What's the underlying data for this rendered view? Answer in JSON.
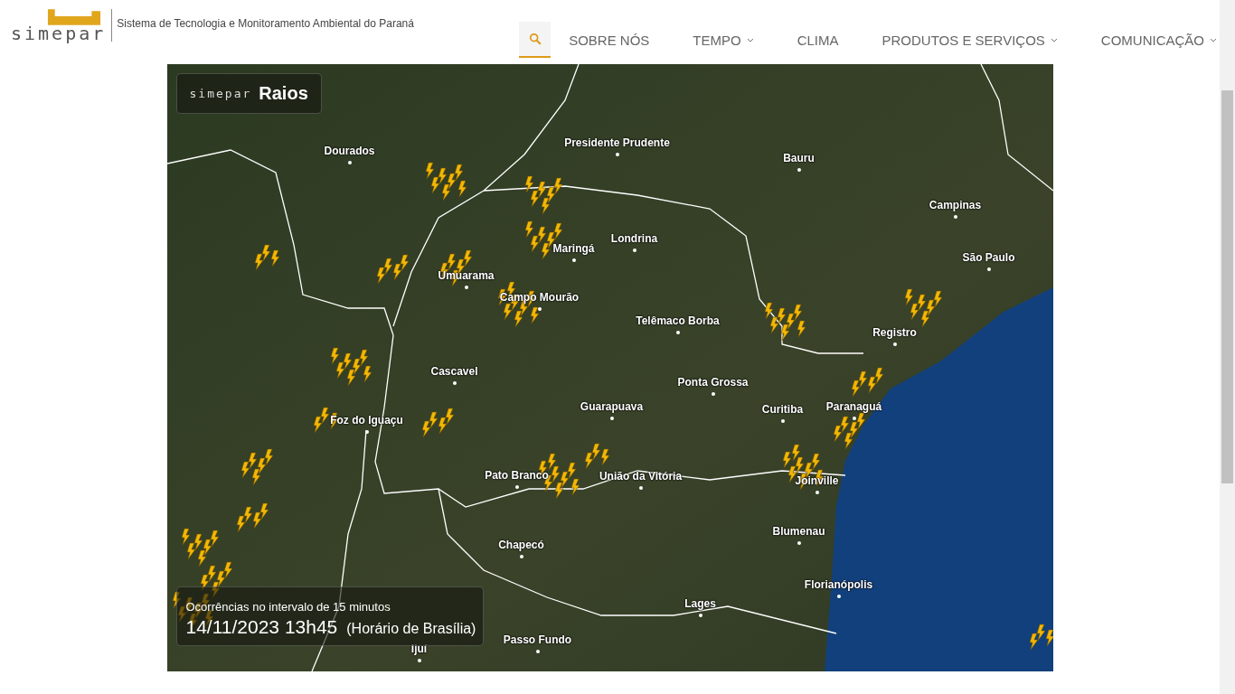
{
  "header": {
    "logo": "simepar",
    "tagline": "Sistema de Tecnologia e Monitoramento Ambiental do Paraná"
  },
  "nav": [
    {
      "label": "SOBRE NÓS",
      "dropdown": false
    },
    {
      "label": "TEMPO",
      "dropdown": true
    },
    {
      "label": "CLIMA",
      "dropdown": false
    },
    {
      "label": "PRODUTOS E SERVIÇOS",
      "dropdown": true
    },
    {
      "label": "COMUNICAÇÃO",
      "dropdown": true
    }
  ],
  "map": {
    "badge": {
      "logo": "simepar",
      "title": "Raios"
    },
    "cities": [
      {
        "name": "Dourados"
      },
      {
        "name": "Presidente Prudente"
      },
      {
        "name": "Bauru"
      },
      {
        "name": "Campinas"
      },
      {
        "name": "São Paulo"
      },
      {
        "name": "Maringá"
      },
      {
        "name": "Londrina"
      },
      {
        "name": "Umuarama"
      },
      {
        "name": "Campo Mourão"
      },
      {
        "name": "Telêmaco Borba"
      },
      {
        "name": "Registro"
      },
      {
        "name": "Cascavel"
      },
      {
        "name": "Ponta Grossa"
      },
      {
        "name": "Guarapuava"
      },
      {
        "name": "Curitiba"
      },
      {
        "name": "Paranaguá"
      },
      {
        "name": "Foz do Iguaçu"
      },
      {
        "name": "Pato Branco"
      },
      {
        "name": "União da Vitória"
      },
      {
        "name": "Joinville"
      },
      {
        "name": "Blumenau"
      },
      {
        "name": "Chapecó"
      },
      {
        "name": "Florianópolis"
      },
      {
        "name": "Lages"
      },
      {
        "name": "Passo Fundo"
      },
      {
        "name": "Ijuí"
      }
    ],
    "caption": {
      "note": "Ocorrências no intervalo de 15 minutos",
      "datetime": "14/11/2023 13h45",
      "timezone": "(Horário de Brasília)"
    }
  }
}
